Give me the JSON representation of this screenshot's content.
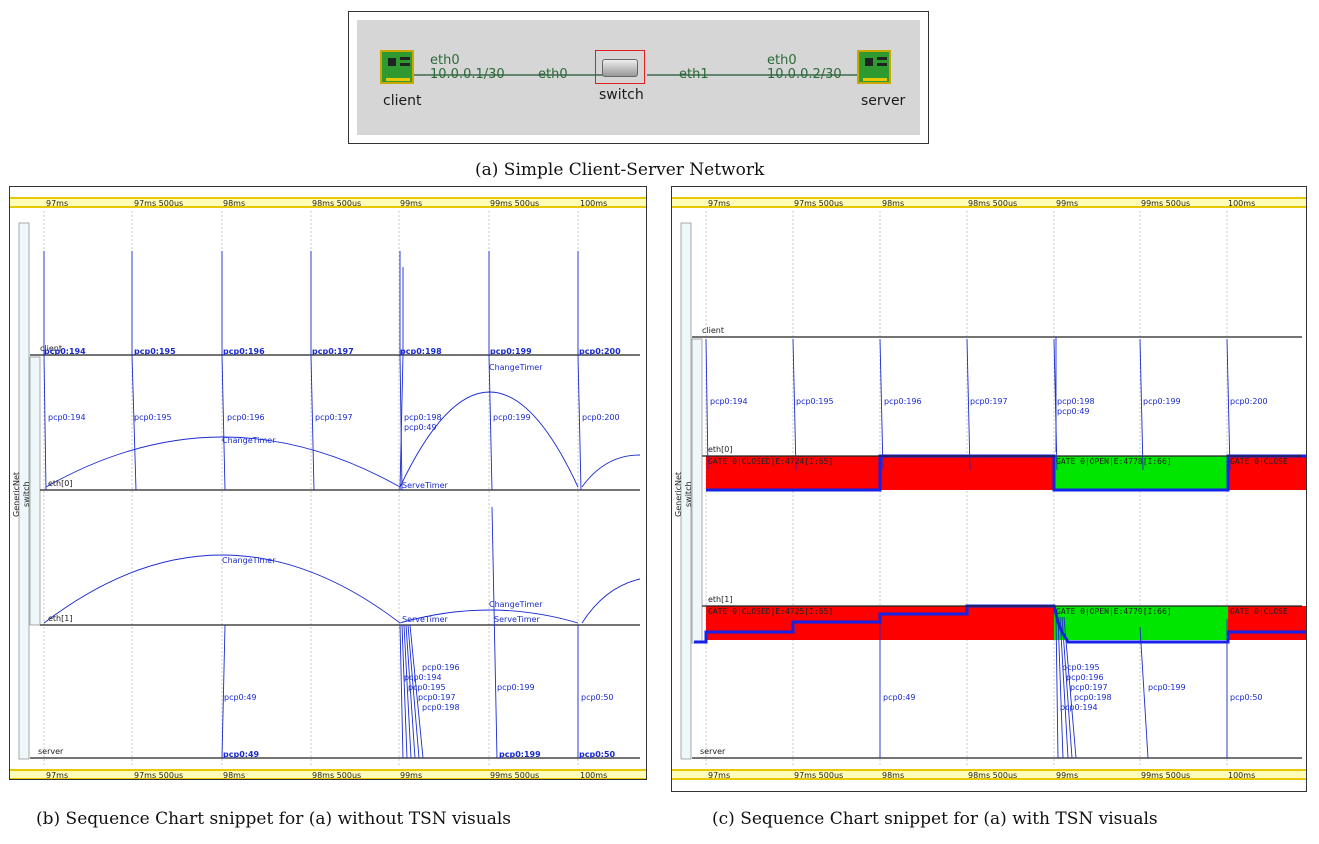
{
  "network": {
    "nodes": {
      "client": "client",
      "switch": "switch",
      "server": "server"
    },
    "client_if": {
      "name": "eth0",
      "addr": "10.0.0.1/30"
    },
    "switch_if0": "eth0",
    "switch_if1": "eth1",
    "server_if": {
      "name": "eth0",
      "addr": "10.0.0.2/30"
    },
    "caption": "(a) Simple Client-Server Network"
  },
  "captions": {
    "b": "(b) Sequence Chart snippet for (a) without TSN visuals",
    "c": "(c) Sequence Chart snippet for (a) with TSN visuals"
  },
  "time_ticks": [
    "97ms",
    "97ms 500us",
    "98ms",
    "98ms 500us",
    "99ms",
    "99ms 500us",
    "100ms"
  ],
  "axes": {
    "genericnet": "GenericNet",
    "switch": "switch",
    "client": "client",
    "eth0": "eth[0]",
    "eth1": "eth[1]",
    "server": "server"
  },
  "chart_b": {
    "down_msgs": [
      "pcp0:194",
      "pcp0:195",
      "pcp0:196",
      "pcp0:197",
      "pcp0:198",
      "pcp0:49",
      "pcp0:199",
      "pcp0:200"
    ],
    "server_msgs": [
      "pcp0:196",
      "pcp0:194",
      "pcp0:195",
      "pcp0:197",
      "pcp0:198"
    ],
    "server_other": [
      "pcp0:49",
      "pcp0:199",
      "pcp0:50"
    ],
    "timers": {
      "change": "ChangeTimer",
      "serve": "ServeTimer"
    },
    "client_events": [
      "pcp0:194",
      "pcp0:195",
      "pcp0:196",
      "pcp0:197",
      "pcp0:198",
      "pcp0:199",
      "pcp0:200"
    ],
    "server_events": [
      "pcp0:49",
      "pcp0:199",
      "pcp0:50"
    ]
  },
  "chart_c": {
    "down_msgs": [
      "pcp0:194",
      "pcp0:195",
      "pcp0:196",
      "pcp0:197",
      "pcp0:198",
      "pcp0:49",
      "pcp0:199",
      "pcp0:200"
    ],
    "server_msgs": [
      "pcp0:195",
      "pcp0:196",
      "pcp0:197",
      "pcp0:198",
      "pcp0:194"
    ],
    "server_other": [
      "pcp0:49",
      "pcp0:199",
      "pcp0:50"
    ],
    "gates_eth0": [
      "GATE 0|CLOSED|E:4724[I:65]",
      "GATE 0|OPEN|E:4778[I:66]",
      "GATE 0|CLOSE"
    ],
    "gates_eth1": [
      "GATE 0|CLOSED|E:4725[I:65]",
      "GATE 0|OPEN|E:4779[I:66]",
      "GATE 0|CLOSE"
    ]
  },
  "colors": {
    "msg": "#1a2bd0",
    "closed": "#ff0000",
    "open": "#00e600",
    "ruler": "#fffdb8"
  }
}
